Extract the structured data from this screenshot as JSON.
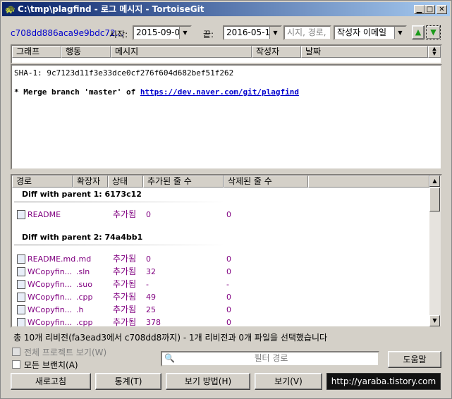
{
  "window": {
    "title": "C:\\tmp\\plagfind - 로그 메시지 - TortoiseGit"
  },
  "filter": {
    "revision": "c708dd886aca9e9bdc72...",
    "from_label": "시작:",
    "from_date": "2015-09-08",
    "to_label": "끝:",
    "to_date": "2016-05-10",
    "search_placeholder": "시지, 경로, ",
    "search_field": "작성자 이메일"
  },
  "log_columns": [
    "그래프",
    "행동",
    "메시지",
    "작성자",
    "날짜"
  ],
  "message": {
    "sha": "SHA-1: 9c7123d11f3e33dce0cf276f604d682bef51f262",
    "line_prefix": "* Merge branch 'master' of ",
    "link": "https://dev.naver.com/git/plagfind"
  },
  "file_columns": [
    "경로",
    "확장자",
    "상태",
    "추가된 줄 수",
    "삭제된 줄 수"
  ],
  "groups": [
    {
      "title": "Diff with parent 1: 6173c12",
      "files": [
        {
          "path": "README",
          "ext": "",
          "status": "추가됨",
          "added": "0",
          "deleted": "0",
          "icon": "text-file-icon"
        }
      ]
    },
    {
      "title": "Diff with parent 2: 74a4bb1",
      "files": [
        {
          "path": "README.md",
          "ext": ".md",
          "status": "추가됨",
          "added": "0",
          "deleted": "0",
          "icon": "text-file-icon"
        },
        {
          "path": "WCopyfin...",
          "ext": ".sln",
          "status": "추가됨",
          "added": "32",
          "deleted": "0",
          "icon": "solution-file-icon"
        },
        {
          "path": "WCopyfin...",
          "ext": ".suo",
          "status": "추가됨",
          "added": "-",
          "deleted": "-",
          "icon": "user-options-file-icon"
        },
        {
          "path": "WCopyfin...",
          "ext": ".cpp",
          "status": "추가됨",
          "added": "49",
          "deleted": "0",
          "icon": "cpp-file-icon"
        },
        {
          "path": "WCopyfin...",
          "ext": ".h",
          "status": "추가됨",
          "added": "25",
          "deleted": "0",
          "icon": "header-file-icon"
        },
        {
          "path": "WCopyfin...",
          "ext": ".cpp",
          "status": "추가됨",
          "added": "378",
          "deleted": "0",
          "icon": "cpp-file-icon"
        }
      ]
    }
  ],
  "status_text": "총 10개 리비전(fa3ead3에서 c708dd8까지) - 1개 리비전과 0개 파일을 선택했습니다",
  "options": {
    "whole_project": "전체 프로젝트 보기(W)",
    "all_branches": "모든 브랜치(A)"
  },
  "path_filter_placeholder": "필터 경로",
  "buttons": {
    "help": "도움말",
    "refresh": "새로고침",
    "statistics": "통계(T)",
    "view_mode": "보기 방법(H)",
    "view": "보기(V)"
  },
  "watermark": "http://yaraba.tistory.com"
}
